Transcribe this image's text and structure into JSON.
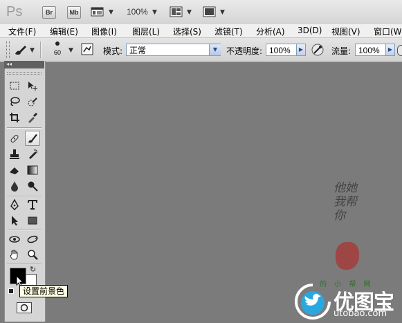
{
  "app": {
    "logo": "Ps",
    "bridge_btn": "Br",
    "minibridge_btn": "Mb",
    "zoom": "100%"
  },
  "menu": [
    "文件(F)",
    "编辑(E)",
    "图像(I)",
    "图层(L)",
    "选择(S)",
    "滤镜(T)",
    "分析(A)",
    "3D(D)",
    "视图(V)",
    "窗口(W)"
  ],
  "options": {
    "brush_size": "60",
    "mode_label": "模式:",
    "mode_value": "正常",
    "opacity_label": "不透明度:",
    "opacity_value": "100%",
    "flow_label": "流量:",
    "flow_value": "100%"
  },
  "tools": {
    "tooltip": "设置前景色",
    "fg_color": "#000000",
    "bg_color": "#ffffff"
  },
  "watermark": {
    "handwriting": "他她我帮你",
    "small": "的 小 帮 网",
    "brand": "优图宝",
    "url": "utobao.com"
  }
}
